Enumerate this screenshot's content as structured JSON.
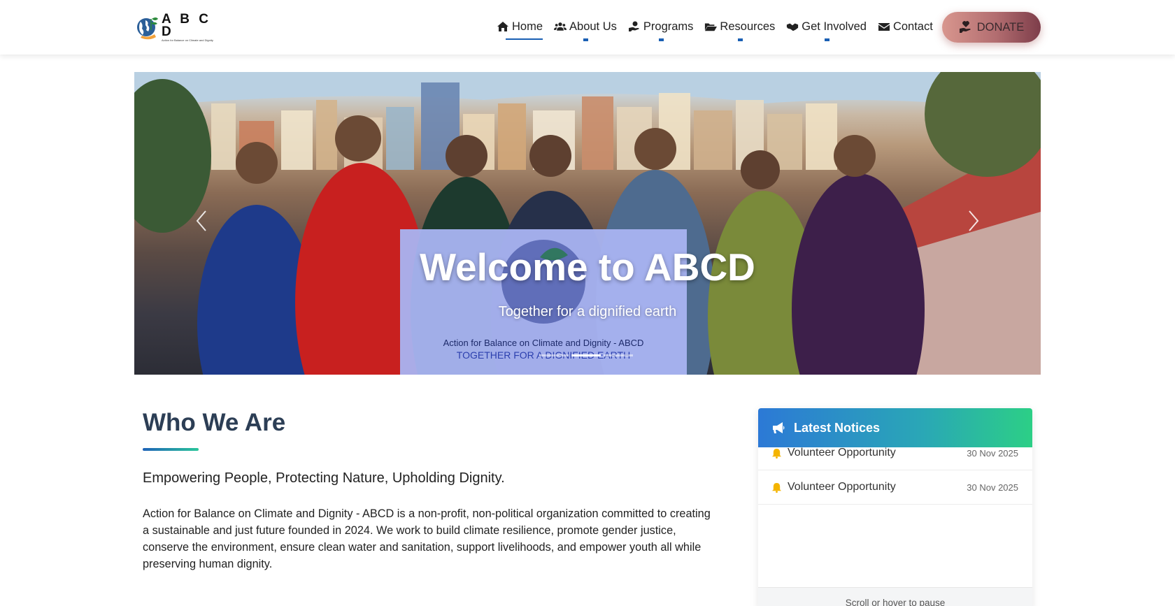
{
  "brand": {
    "letters": "A B C D",
    "tagline": "Action for Balance on Climate and Dignity"
  },
  "nav": {
    "items": [
      {
        "label": "Home",
        "icon": "home-icon",
        "active": true
      },
      {
        "label": "About Us",
        "icon": "users-icon"
      },
      {
        "label": "Programs",
        "icon": "hand-holding-icon"
      },
      {
        "label": "Resources",
        "icon": "folder-open-icon"
      },
      {
        "label": "Get Involved",
        "icon": "handshake-icon"
      },
      {
        "label": "Contact",
        "icon": "envelope-icon"
      }
    ],
    "donate_label": "DONATE",
    "donate_icon": "hand-holding-heart-icon"
  },
  "hero": {
    "title": "Welcome to ABCD",
    "subtitle": "Together for a dignified earth",
    "banner_line1": "Action for Balance on Climate and Dignity - ABCD",
    "banner_line2": "TOGETHER FOR A DIGNIFIED EARTH",
    "slides": 3,
    "active_slide": 1
  },
  "who": {
    "title": "Who We Are",
    "tagline": "Empowering People, Protecting Nature, Upholding Dignity.",
    "body": "Action for Balance on Climate and Dignity - ABCD is a non-profit, non-political organization committed to creating a sustainable and just future founded in 2024. We work to build climate resilience, promote gender justice, conserve the environment, ensure clean water and sanitation, support livelihoods, and empower youth all while preserving human dignity."
  },
  "notices": {
    "title": "Latest Notices",
    "items": [
      {
        "title": "Volunteer Opportunity",
        "date": "30 Nov 2025"
      },
      {
        "title": "Volunteer Opportunity",
        "date": "30 Nov 2025"
      }
    ],
    "footer": "Scroll or hover to pause"
  },
  "colors": {
    "primary": "#1a5fb4",
    "heading": "#2c3e55",
    "accent_green": "#2ccf86",
    "donate": "#b26d70",
    "bell": "#f4b400"
  }
}
